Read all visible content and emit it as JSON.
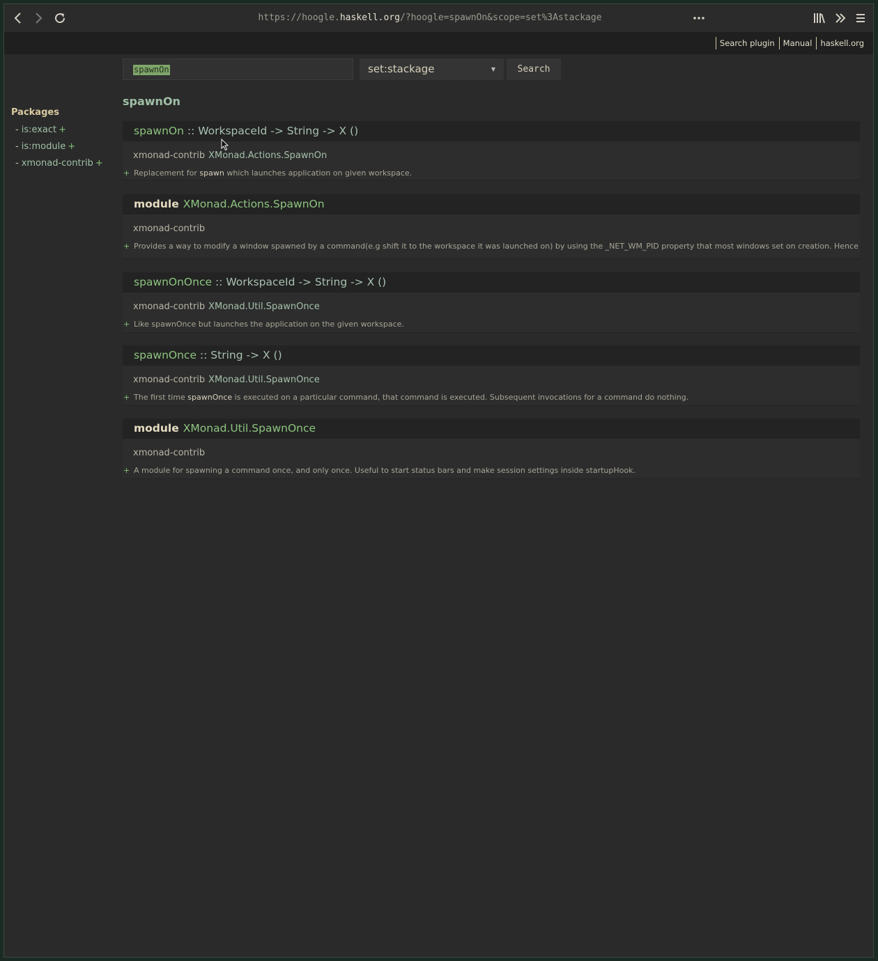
{
  "browser": {
    "url_prefix": "https://hoogle.",
    "url_host": "haskell.org",
    "url_suffix": "/?hoogle=spawnOn&scope=set%3Astackage",
    "back_icon": "chevron-left-icon",
    "forward_icon": "chevron-right-icon",
    "reload_icon": "reload-icon",
    "more_icon": "ellipsis-icon",
    "library_icon": "library-icon",
    "overflow_icon": "double-chevron-icon",
    "menu_icon": "hamburger-icon"
  },
  "toplinks": [
    "Search plugin",
    "Manual",
    "haskell.org"
  ],
  "search": {
    "query": "spawnOn",
    "scope": "set:stackage",
    "button": "Search"
  },
  "sidebar": {
    "title": "Packages",
    "items": [
      {
        "dash": "-",
        "label": "is:exact",
        "plus": "+"
      },
      {
        "dash": "-",
        "label": "is:module",
        "plus": "+"
      },
      {
        "dash": "-",
        "label": "xmonad-contrib",
        "plus": "+"
      }
    ]
  },
  "results_title": "spawnOn",
  "results": [
    {
      "name": "spawnOn",
      "signature": " :: WorkspaceId -> String -> X ()",
      "package": "xmonad-contrib",
      "module": "XMonad.Actions.SpawnOn",
      "doc_pre": "Replacement for ",
      "doc_code": "spawn",
      "doc_post": " which launches application on given workspace.",
      "expand": "+"
    },
    {
      "keyword": "module",
      "name": "XMonad.Actions.SpawnOn",
      "package": "xmonad-contrib",
      "doc_pre": "Provides a way to modify a window spawned by a command(e.g shift it to the workspace it was launched on) by using the _NET_WM_PID property that most windows set on creation. Hence this module won't work on applications that don't set this property.",
      "expand": "+"
    },
    {
      "name": "spawnOnOnce",
      "signature": " :: WorkspaceId -> String -> X ()",
      "package": "xmonad-contrib",
      "module": "XMonad.Util.SpawnOnce",
      "doc_pre": "Like spawnOnce but launches the application on the given workspace.",
      "expand": "+"
    },
    {
      "name": "spawnOnce",
      "signature": " :: String -> X ()",
      "package": "xmonad-contrib",
      "module": "XMonad.Util.SpawnOnce",
      "doc_pre": "The first time ",
      "doc_code": "spawnOnce",
      "doc_post": " is executed on a particular command, that command is executed. Subsequent invocations for a command do nothing.",
      "expand": "+"
    },
    {
      "keyword": "module",
      "name": "XMonad.Util.SpawnOnce",
      "package": "xmonad-contrib",
      "doc_pre": "A module for spawning a command once, and only once. Useful to start status bars and make session settings inside startupHook.",
      "expand": "+"
    }
  ]
}
